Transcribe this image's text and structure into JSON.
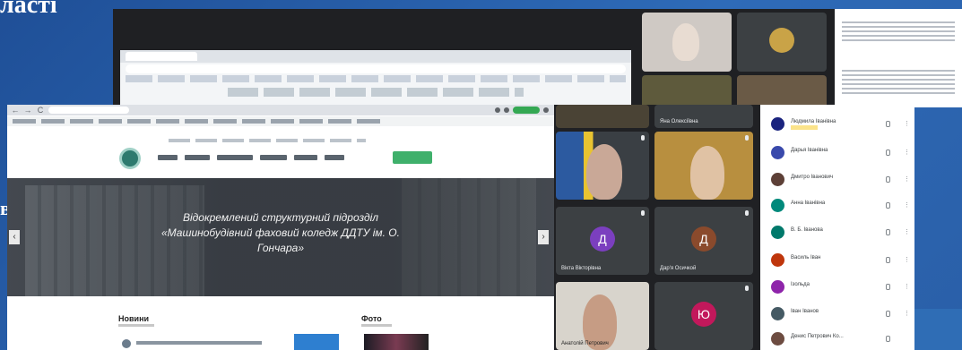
{
  "slide": {
    "title_fragment": "ласті",
    "side_letter": "в"
  },
  "browser": {
    "nav_back": "←",
    "nav_forward": "→",
    "nav_reload": "C",
    "hero_text": "Відокремлений структурний підрозділ «Машинобудівний фаховий коледж ДДТУ ім. О. Гончара»",
    "hero_prev": "‹",
    "hero_next": "›",
    "news_title": "Новини",
    "photo_title": "Фото"
  },
  "meet_tiles": [
    {
      "name": "Яна Олексіївна"
    },
    {
      "name": ""
    },
    {
      "name": ""
    },
    {
      "name": "Вікта Вікторівна",
      "initial": "Д"
    },
    {
      "name": "Дар'я Осичкой",
      "initial": "Д"
    },
    {
      "name": "Анатолій Петрович"
    },
    {
      "name": "",
      "initial": "Ю"
    }
  ],
  "participants": [
    {
      "name": "Людмила Іванівна",
      "sub": "Вимкнено"
    },
    {
      "name": "Дарья Іванівна"
    },
    {
      "name": "Дмитро Іванович"
    },
    {
      "name": "Анна Іванівна"
    },
    {
      "name": "В. Б. Іванова"
    },
    {
      "name": "Василь Іван"
    },
    {
      "name": "Ізольда"
    },
    {
      "name": "Іван Іванов"
    },
    {
      "name": "Денис Петрович Ко..."
    }
  ],
  "colors": {
    "slide_bg": "#2b5ea7",
    "meet_bg": "#202124",
    "accent_green": "#3fb06b"
  }
}
